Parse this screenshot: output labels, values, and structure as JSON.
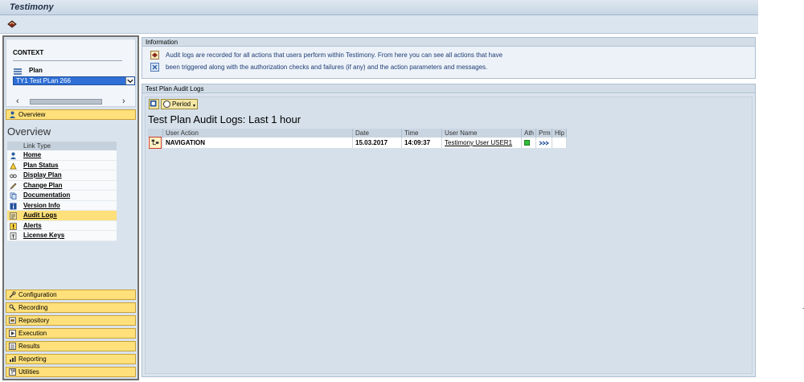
{
  "window": {
    "title": "Testimony"
  },
  "context": {
    "title": "CONTEXT",
    "plan_label": "Plan",
    "plan_value": "TY1  Test PLan 266"
  },
  "nav": {
    "overview_button": "Overview",
    "overview_title": "Overview",
    "link_type_header": "Link Type",
    "links": [
      {
        "label": "Home",
        "icon": "person-icon"
      },
      {
        "label": "Plan Status",
        "icon": "status-icon"
      },
      {
        "label": "Display Plan",
        "icon": "glasses-icon"
      },
      {
        "label": "Change Plan",
        "icon": "pencil-icon"
      },
      {
        "label": "Documentation",
        "icon": "document-icon"
      },
      {
        "label": "Version Info",
        "icon": "info-icon"
      },
      {
        "label": "Audit Logs",
        "icon": "audit-icon",
        "active": true
      },
      {
        "label": "Alerts",
        "icon": "alert-icon"
      },
      {
        "label": "License Keys",
        "icon": "key-icon"
      }
    ],
    "sections": [
      "Configuration",
      "Recording",
      "Repository",
      "Execution",
      "Results",
      "Reporting",
      "Utilities"
    ]
  },
  "information": {
    "header": "Information",
    "line1": "Audit logs are recorded for all actions that users perform within Testimony. From here you can see all actions that have",
    "line2": "been triggered along with the authorization checks and failures (if any) and the action parameters and messages."
  },
  "audit": {
    "header": "Test Plan Audit Logs",
    "period_button": "Period",
    "report_title": "Test Plan Audit Logs: Last 1 hour",
    "columns": [
      "User Action",
      "Date",
      "Time",
      "User Name",
      "Ath",
      "Prm",
      "Hlp"
    ],
    "rows": [
      {
        "action": "NAVIGATION",
        "date": "15.03.2017",
        "time": "14:09:37",
        "user": "Testimony User USER1",
        "ath": "green",
        "prm": "params-icon",
        "hlp": ""
      }
    ]
  },
  "colors": {
    "accent": "#ffe07a",
    "selection": "#2f6fd6",
    "panel": "#dbe4ee"
  }
}
